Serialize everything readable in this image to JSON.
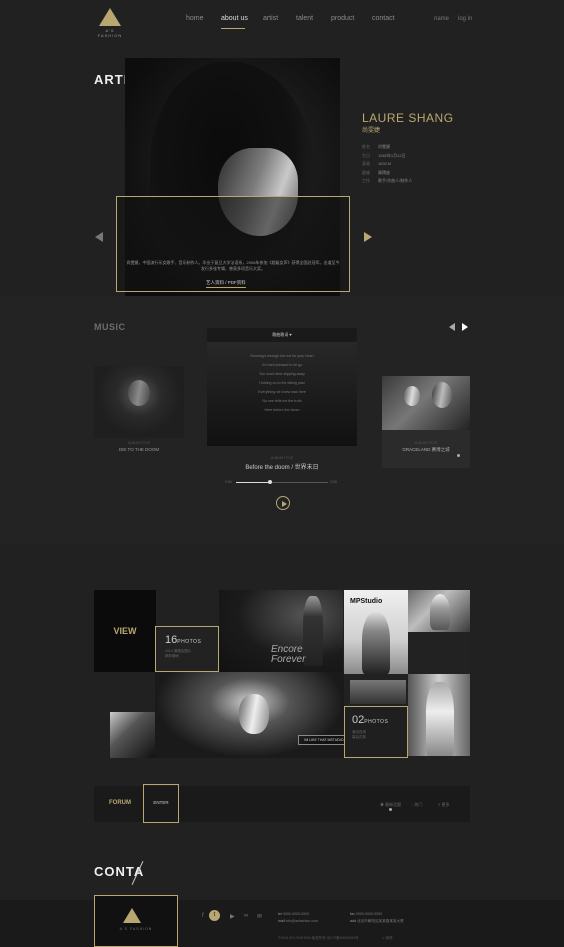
{
  "header": {
    "logo_text": "A'S FASHION",
    "nav": [
      "home",
      "about us",
      "artist",
      "talent",
      "product",
      "contact"
    ],
    "active_nav": "about us",
    "lang": [
      "name",
      "log in"
    ]
  },
  "artist": {
    "section_title": "ARTIST",
    "name_en": "LAURE SHANG",
    "name_zh": "尚雯婕",
    "info": [
      {
        "k": "姓名",
        "v": "尚雯婕"
      },
      {
        "k": "生日",
        "v": "1982年1月12日"
      },
      {
        "k": "身高",
        "v": "163CM"
      },
      {
        "k": "星座",
        "v": "摩羯座"
      },
      {
        "k": "工作",
        "v": "歌手/作曲人/制作人"
      }
    ],
    "bio": "尚雯婕，中国流行乐女歌手、音乐制作人。毕业于复旦大学法语系，2006年参加《超级女声》获得全国总冠军。出道至今发行多张专辑，曾获多项音乐大奖。",
    "bio_link": "艺人资料 / PDF资料"
  },
  "music": {
    "section_title": "MUSIC",
    "left_card": {
      "sub": "ALBUM TITLE",
      "title": "DIE TO THE DOOM"
    },
    "lyric_header": "歌曲歌词",
    "lyrics": [
      "Running's enough but not for your heart",
      "I'm hard pressed to let go",
      "Too much time slipping away",
      "Holding on to the falling past",
      "Everything we knew was here",
      "No one tells me the truth",
      "Here before the doom"
    ],
    "song_sub": "ALBUM TITLE",
    "song_title": "Before the doom / 世界末日",
    "time_start": "0:00",
    "time_end": "3:28",
    "progress": 0.37,
    "right_card": {
      "sub": "ALBUM TITLE",
      "title": "GRACELAND 赛博之城"
    }
  },
  "gallery": {
    "view_label": "VIEW",
    "count_a": {
      "num": "16",
      "unit": "PHOTOS",
      "lines": [
        "2014 演唱会图片",
        "精彩瞬间"
      ]
    },
    "encore_text": [
      "Encore",
      "Forever"
    ],
    "mps_text": "MPStudio",
    "curly_label": "IM LIKE THAT MSTUDIO",
    "count_b": {
      "num": "02",
      "unit": "PHOTOS",
      "lines": [
        "演出现场",
        "幕后花絮"
      ]
    }
  },
  "forum": {
    "title": "FORUM",
    "enter": "ENTER",
    "links": [
      "最新话题",
      "热门",
      "更多"
    ]
  },
  "contact": {
    "section_title": "CONTA",
    "social": [
      "f",
      "t",
      "▶",
      "∞",
      "✉"
    ],
    "tel_label": "tel",
    "tel": "4000-0000-0000",
    "mail_label": "mail",
    "mail": "info@asfashion.com",
    "fax_label": "fax",
    "fax": "0000-0000-0000",
    "addr_label": "add",
    "addr": "北京市朝阳区某某路某某大厦",
    "copyright": "©2014 A'S FASHION 版权所有 京ICP备00000000号",
    "weibo": "微博"
  },
  "colors": {
    "accent": "#b9a772",
    "background": "#212121"
  }
}
